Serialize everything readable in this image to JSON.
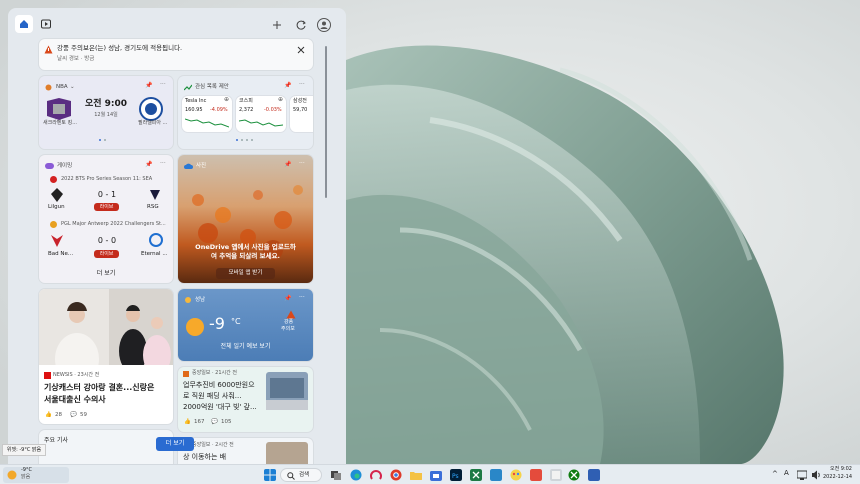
{
  "panel": {
    "home_icon": "home-icon",
    "video_icon": "video-icon",
    "add_icon": "plus-icon",
    "refresh_icon": "refresh-icon",
    "account_icon": "person-icon"
  },
  "alert": {
    "title": "강풍 주의보은(는) 성남, 경기도에 적용됩니다.",
    "subtitle": "날씨 경보 · 방금"
  },
  "nba": {
    "label": "NBA",
    "team_left": "새크라멘토 킹...",
    "time": "오전 9:00",
    "date": "12월 14일",
    "team_right": "필라델피아 ..."
  },
  "stocks": {
    "label": "관심 목록 제안",
    "items": [
      {
        "name": "Tesla Inc",
        "price": "160.95",
        "change": "-4.09%"
      },
      {
        "name": "코스피",
        "price": "2,372",
        "change": "-0.03%"
      },
      {
        "name": "삼성전",
        "price": "59,70",
        "change": ""
      }
    ]
  },
  "games": {
    "label": "게이밍",
    "match1": {
      "title": "2022 BTS Pro Series Season 11: SEA",
      "team_left": "Lilgun",
      "score": "0 - 1",
      "team_right": "RSG",
      "status": "라이브"
    },
    "match2": {
      "title": "PGL Major Antwerp 2022 Challengers St...",
      "team_left": "Bad Ne...",
      "score": "0 - 0",
      "team_right": "Eternal ...",
      "status": "라이브"
    },
    "more": "더 보기"
  },
  "photos": {
    "label": "사진",
    "text_line1": "OneDrive 앱에서 사진을 업로드하",
    "text_line2": "여 추억을 되살려 보세요.",
    "button": "모바일 앱 받기"
  },
  "weather": {
    "city": "성남",
    "temp": "-9",
    "unit": "°C",
    "side1": "강풍",
    "side2": "주의보",
    "link": "전체 일기 예보 보기"
  },
  "news1": {
    "source": "NEWSIS · 23시간 전",
    "headline1": "기상캐스터 강아랑 결혼...신랑은",
    "headline2": "서울대출신 수의사",
    "likes": "28",
    "comments": "59"
  },
  "news2": {
    "source": "중앙일보 · 21시간 전",
    "headline1": "업무추진비 6000만원으",
    "headline2": "로 직원 패딩 사줘...",
    "headline3": "2000억원 '대구 빚' 갚...",
    "likes": "167",
    "comments": "105"
  },
  "news3": {
    "label": "주요 기사"
  },
  "news4": {
    "source": "중앙일보 · 2시간 전",
    "headline": "상 이동하는 배"
  },
  "more_button": "더 보기",
  "widget_tooltip": "위젯: -9°C 맑음",
  "taskbar": {
    "weather_temp": "-9°C",
    "weather_desc": "맑음",
    "search": "검색",
    "lang": "A",
    "time": "오전 9:02",
    "date": "2022-12-14"
  }
}
